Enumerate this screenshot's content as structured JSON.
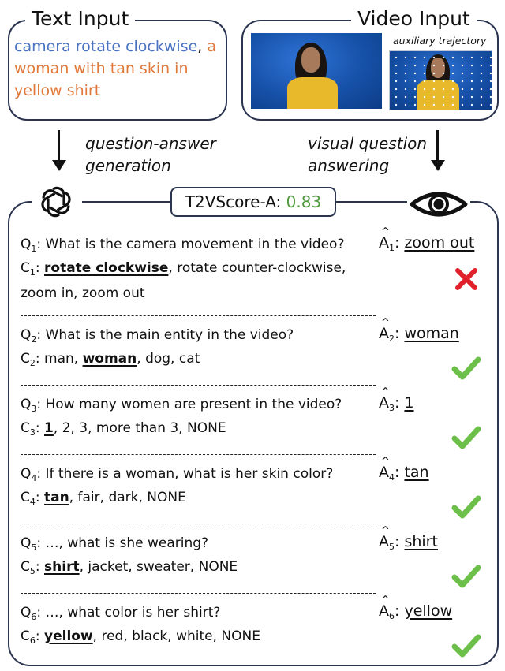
{
  "text_input": {
    "title": "Text Input",
    "prompt_part1": "camera rotate clockwise",
    "prompt_sep": ", ",
    "prompt_part2": "a woman with tan skin in yellow shirt",
    "colors": {
      "camera": "#4a72c2",
      "content": "#e0783a"
    }
  },
  "video_input": {
    "title": "Video Input",
    "aux_label": "auxiliary trajectory"
  },
  "arrows": {
    "left_label_line1": "question-answer",
    "left_label_line2": "generation",
    "right_label_line1": "visual question",
    "right_label_line2": "answering"
  },
  "icons": {
    "left": "openai-logo-icon",
    "right": "eye-icon"
  },
  "score": {
    "label": "T2VScore-A: ",
    "value": "0.83",
    "value_color": "#4f9a3c"
  },
  "qa_items": [
    {
      "q_idx": "1",
      "question": "What is the camera movement in the video?",
      "choices_pre": "",
      "choices_correct": "rotate clockwise",
      "choices_post": ", rotate counter-clockwise,",
      "choices_line2": "zoom in, zoom out",
      "answer": "zoom out",
      "result": "wrong"
    },
    {
      "q_idx": "2",
      "question": "What is the main entity in the video?",
      "choices_pre": "man, ",
      "choices_correct": "woman",
      "choices_post": ", dog, cat",
      "answer": "woman",
      "result": "correct"
    },
    {
      "q_idx": "3",
      "question": "How many women are present in the video?",
      "choices_pre": "",
      "choices_correct": "1",
      "choices_post": ", 2, 3, more than 3, NONE",
      "answer": "1",
      "result": "correct"
    },
    {
      "q_idx": "4",
      "question": "If there is a woman, what is her skin color?",
      "choices_pre": "",
      "choices_correct": "tan",
      "choices_post": ", fair, dark, NONE",
      "answer": "tan",
      "result": "correct"
    },
    {
      "q_idx": "5",
      "question": "…, what is she wearing?",
      "choices_pre": "",
      "choices_correct": "shirt",
      "choices_post": ", jacket, sweater, NONE",
      "answer": "shirt",
      "result": "correct"
    },
    {
      "q_idx": "6",
      "question": "…, what color is her shirt?",
      "choices_pre": "",
      "choices_correct": "yellow",
      "choices_post": ", red, black, white, NONE",
      "answer": "yellow",
      "result": "correct"
    }
  ],
  "labels": {
    "q": "Q",
    "c": "C",
    "a": "A",
    "colon": ": "
  },
  "colors": {
    "correct": "#6cc04a",
    "wrong": "#e0202a",
    "border": "#2b3550"
  }
}
